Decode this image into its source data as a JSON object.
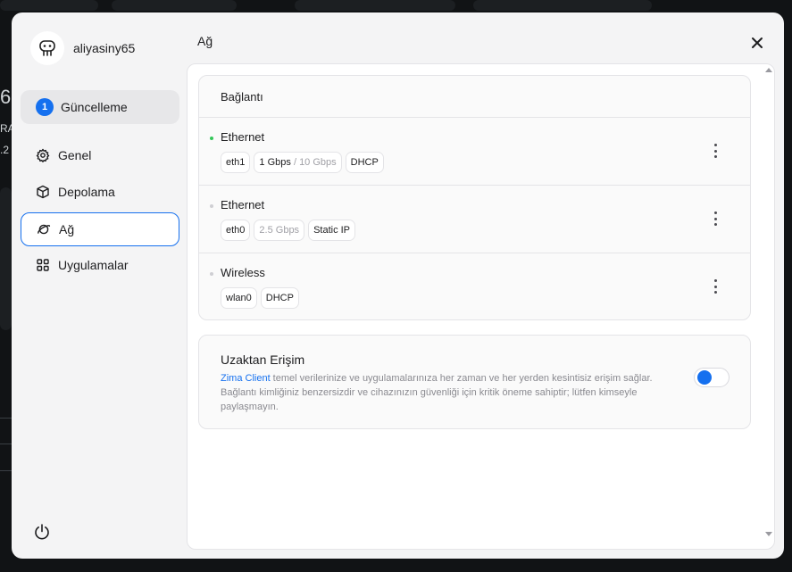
{
  "user": {
    "name": "aliyasiny65",
    "avatar_icon": "robot-avatar-icon"
  },
  "sidebar": {
    "update": {
      "badge": "1",
      "label": "Güncelleme"
    },
    "items": [
      {
        "label": "Genel",
        "icon": "gear-icon"
      },
      {
        "label": "Depolama",
        "icon": "cube-icon"
      },
      {
        "label": "Ağ",
        "icon": "planet-icon",
        "active": true
      },
      {
        "label": "Uygulamalar",
        "icon": "grid-icon"
      }
    ],
    "power_icon": "power-icon"
  },
  "main": {
    "title": "Ağ",
    "close_icon": "close-icon",
    "connections": {
      "title": "Bağlantı",
      "items": [
        {
          "name": "Ethernet",
          "status": "connected",
          "iface": "eth1",
          "speed": "1 Gbps",
          "speed_max": "/ 10 Gbps",
          "mode": "DHCP"
        },
        {
          "name": "Ethernet",
          "status": "disconnected",
          "iface": "eth0",
          "speed": "2.5 Gbps",
          "mode": "Static IP"
        },
        {
          "name": "Wireless",
          "status": "disconnected",
          "iface": "wlan0",
          "mode": "DHCP"
        }
      ]
    },
    "remote": {
      "title": "Uzaktan Erişim",
      "link": "Zima Client",
      "desc": " temel verilerinize ve uygulamalarınıza her zaman ve her yerden kesintisiz erişim sağlar. Bağlantı kimliğiniz benzersizdir ve cihazınızın güvenliği için kritik öneme sahiptir; lütfen kimseyle paylaşmayın.",
      "toggle_on": false
    }
  },
  "colors": {
    "accent": "#1570ef",
    "connected": "#34c759",
    "muted": "#a0a0a6"
  },
  "background": {
    "fragments": [
      "6",
      "RA",
      ".2"
    ]
  }
}
